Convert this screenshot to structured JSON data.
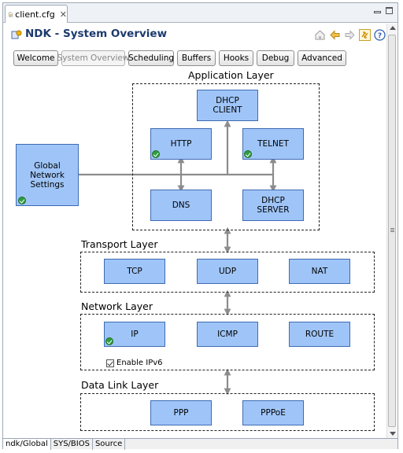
{
  "editor_tab": {
    "label": "client.cfg"
  },
  "header": {
    "title": "NDK - System Overview"
  },
  "nav_buttons": [
    {
      "label": "Welcome"
    },
    {
      "label": "System Overview"
    },
    {
      "label": "Scheduling"
    },
    {
      "label": "Buffers"
    },
    {
      "label": "Hooks"
    },
    {
      "label": "Debug"
    },
    {
      "label": "Advanced"
    }
  ],
  "global_settings": {
    "label": "Global\nNetwork\nSettings"
  },
  "layers": {
    "application": {
      "title": "Application Layer",
      "nodes": [
        "DHCP\nCLIENT",
        "HTTP",
        "TELNET",
        "DNS",
        "DHCP\nSERVER"
      ]
    },
    "transport": {
      "title": "Transport Layer",
      "nodes": [
        "TCP",
        "UDP",
        "NAT"
      ]
    },
    "network": {
      "title": "Network Layer",
      "nodes": [
        "IP",
        "ICMP",
        "ROUTE"
      ],
      "ipv6_label": "Enable IPv6",
      "ipv6_checked": true
    },
    "datalink": {
      "title": "Data Link Layer",
      "nodes": [
        "PPP",
        "PPPoE"
      ]
    }
  },
  "bottom_tabs": [
    "ndk/Global",
    "SYS/BIOS",
    "Source"
  ],
  "colors": {
    "node_fill": "#9fc5f8",
    "node_border": "#3d6bb3",
    "title": "#1c3a6e",
    "connector": "#8c8c8c",
    "check": "#2f9e3e"
  }
}
